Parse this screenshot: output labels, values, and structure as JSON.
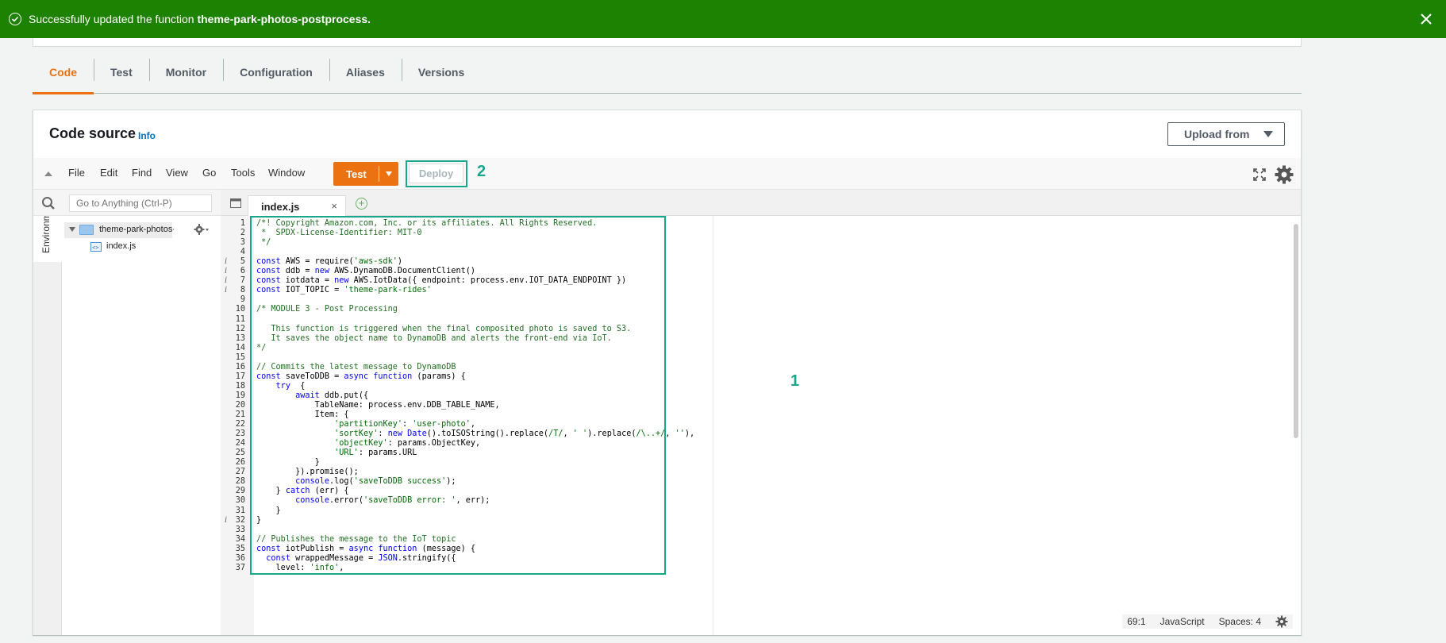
{
  "flash": {
    "prefix": "Successfully updated the function ",
    "function_name": "theme-park-photos-postprocess."
  },
  "tabs": [
    "Code",
    "Test",
    "Monitor",
    "Configuration",
    "Aliases",
    "Versions"
  ],
  "panel": {
    "title": "Code source",
    "info": "Info",
    "upload": "Upload from"
  },
  "menu": [
    "File",
    "Edit",
    "Find",
    "View",
    "Go",
    "Tools",
    "Window"
  ],
  "buttons": {
    "test": "Test",
    "deploy": "Deploy"
  },
  "annotations": {
    "deploy": "2",
    "code": "1"
  },
  "sidebar": {
    "environment": "Environment",
    "search_placeholder": "Go to Anything (Ctrl-P)",
    "folder": "theme-park-photos-postprocess",
    "file": "index.js"
  },
  "editor": {
    "tab": "index.js",
    "tab_close": "×",
    "add": "+",
    "lines": [
      {
        "n": "1",
        "t": "/*! Copyright Amazon.com, Inc. or its affiliates. All Rights Reserved."
      },
      {
        "n": "2",
        "t": " *  SPDX-License-Identifier: MIT-0"
      },
      {
        "n": "3",
        "t": " */"
      },
      {
        "n": "4",
        "t": ""
      },
      {
        "n": "5",
        "t": "const AWS = require('aws-sdk')",
        "i": true
      },
      {
        "n": "6",
        "t": "const ddb = new AWS.DynamoDB.DocumentClient()",
        "i": true
      },
      {
        "n": "7",
        "t": "const iotdata = new AWS.IotData({ endpoint: process.env.IOT_DATA_ENDPOINT })",
        "i": true
      },
      {
        "n": "8",
        "t": "const IOT_TOPIC = 'theme-park-rides'",
        "i": true
      },
      {
        "n": "9",
        "t": ""
      },
      {
        "n": "10",
        "t": "/* MODULE 3 - Post Processing"
      },
      {
        "n": "11",
        "t": ""
      },
      {
        "n": "12",
        "t": "   This function is triggered when the final composited photo is saved to S3."
      },
      {
        "n": "13",
        "t": "   It saves the object name to DynamoDB and alerts the front-end via IoT."
      },
      {
        "n": "14",
        "t": "*/"
      },
      {
        "n": "15",
        "t": ""
      },
      {
        "n": "16",
        "t": "// Commits the latest message to DynamoDB"
      },
      {
        "n": "17",
        "t": "const saveToDDB = async function (params) {"
      },
      {
        "n": "18",
        "t": "    try  {"
      },
      {
        "n": "19",
        "t": "        await ddb.put({"
      },
      {
        "n": "20",
        "t": "            TableName: process.env.DDB_TABLE_NAME,"
      },
      {
        "n": "21",
        "t": "            Item: {"
      },
      {
        "n": "22",
        "t": "                'partitionKey': 'user-photo',"
      },
      {
        "n": "23",
        "t": "                'sortKey': new Date().toISOString().replace(/T/, ' ').replace(/\\..+/, ''),"
      },
      {
        "n": "24",
        "t": "                'objectKey': params.ObjectKey,"
      },
      {
        "n": "25",
        "t": "                'URL': params.URL"
      },
      {
        "n": "26",
        "t": "            }"
      },
      {
        "n": "27",
        "t": "        }).promise();"
      },
      {
        "n": "28",
        "t": "        console.log('saveToDDB success');"
      },
      {
        "n": "29",
        "t": "    } catch (err) {"
      },
      {
        "n": "30",
        "t": "        console.error('saveToDDB error: ', err);"
      },
      {
        "n": "31",
        "t": "    }"
      },
      {
        "n": "32",
        "t": "}",
        "i": true
      },
      {
        "n": "33",
        "t": ""
      },
      {
        "n": "34",
        "t": "// Publishes the message to the IoT topic"
      },
      {
        "n": "35",
        "t": "const iotPublish = async function (message) {"
      },
      {
        "n": "36",
        "t": "  const wrappedMessage = JSON.stringify({"
      },
      {
        "n": "37",
        "t": "    level: 'info',"
      }
    ]
  },
  "status": {
    "position": "69:1",
    "language": "JavaScript",
    "spaces": "Spaces: 4"
  },
  "colors": {
    "success": "#1d8102",
    "accent": "#ec7211",
    "annotation": "#18a78b",
    "link": "#0073bb"
  }
}
